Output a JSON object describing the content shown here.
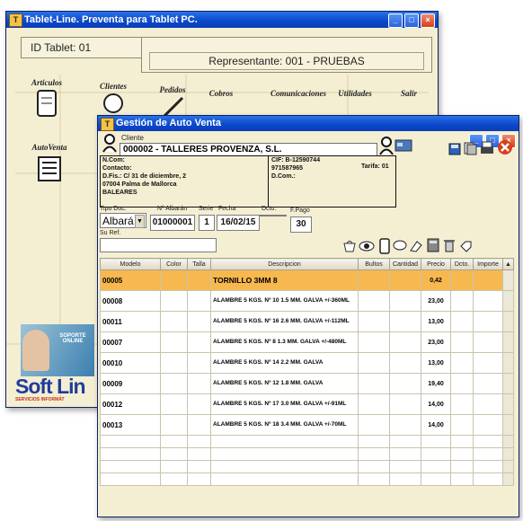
{
  "back_window": {
    "title": "Tablet-Line. Preventa para Tablet PC.",
    "id_tablet": "ID Tablet: 01",
    "representante": "Representante: 001 - PRUEBAS",
    "menu": {
      "articulos": "Articulos",
      "clientes": "Clientes",
      "pedidos": "Pedidos",
      "cobros": "Cobros",
      "comunicaciones": "Comunicaciones",
      "utilidades": "Utilidades",
      "salir": "Salir",
      "autoventa": "AutoVenta"
    },
    "support_banner": "SOPORTE ONLINE",
    "logo_text": "Soft Lin",
    "logo_sub": "SERVICIOS INFORMAT"
  },
  "front_window": {
    "title": "Gestión de Auto Venta",
    "cliente_label": "Cliente",
    "cliente_value": "000002 - TALLERES PROVENZA, S.L.",
    "ncom": "N.Com:",
    "contacto": "Contacto:",
    "dfis": "D.Fis.: C/ 31 de diciembre, 2",
    "cp_ciudad": "07004    Palma de Mallorca",
    "provincia": "BALEARES",
    "cif": "CIF: B-12590744",
    "telefono": "971587965",
    "dcom": "D.Com.:",
    "tarifa": "Tarifa: 01",
    "tipo_doc_label": "Tipo Doc.",
    "tipo_doc_value": "Albará",
    "albaran_label": "Nº Albarán",
    "albaran_value": "01000001",
    "serie_label": "Serie",
    "serie_value": "1",
    "fecha_label": "Fecha",
    "fecha_value": "16/02/15",
    "dcto_label": "Dcto.",
    "fpago_label": "F.Pago",
    "fpago_value": "30",
    "suref_label": "Su Ref.",
    "columns": [
      "Modelo",
      "Color",
      "Talla",
      "Descripcion",
      "Bultos",
      "Cantidad",
      "Precio",
      "Dcto.",
      "Importe"
    ],
    "rows": [
      {
        "modelo": "00005",
        "desc": "TORNILLO 3MM 8",
        "precio": "0,42",
        "selected": true
      },
      {
        "modelo": "00008",
        "desc": "ALAMBRE 5 KGS. Nº 10 1.5 MM. GALVA +/-360ML",
        "precio": "23,00"
      },
      {
        "modelo": "00011",
        "desc": "ALAMBRE 5 KGS. Nº 16 2.6 MM. GALVA +/-112ML",
        "precio": "13,00"
      },
      {
        "modelo": "00007",
        "desc": "ALAMBRE 5 KGS. Nº 8 1.3 MM. GALVA +/-480ML",
        "precio": "23,00"
      },
      {
        "modelo": "00010",
        "desc": "ALAMBRE 5 KGS. Nº 14 2.2 MM. GALVA",
        "precio": "13,00"
      },
      {
        "modelo": "00009",
        "desc": "ALAMBRE 5 KGS. Nº 12 1.8 MM. GALVA",
        "precio": "19,40"
      },
      {
        "modelo": "00012",
        "desc": "ALAMBRE 5 KGS. Nº 17 3.0 MM. GALVA +/-91ML",
        "precio": "14,00"
      },
      {
        "modelo": "00013",
        "desc": "ALAMBRE 5 KGS. Nº 18 3.4 MM. GALVA +/-70ML",
        "precio": "14,00"
      }
    ]
  },
  "colors": {
    "title_bar": "#0b47c9",
    "parchment": "#f4eed3",
    "selected_row": "#f6b84f",
    "close_red": "#d6401a"
  }
}
